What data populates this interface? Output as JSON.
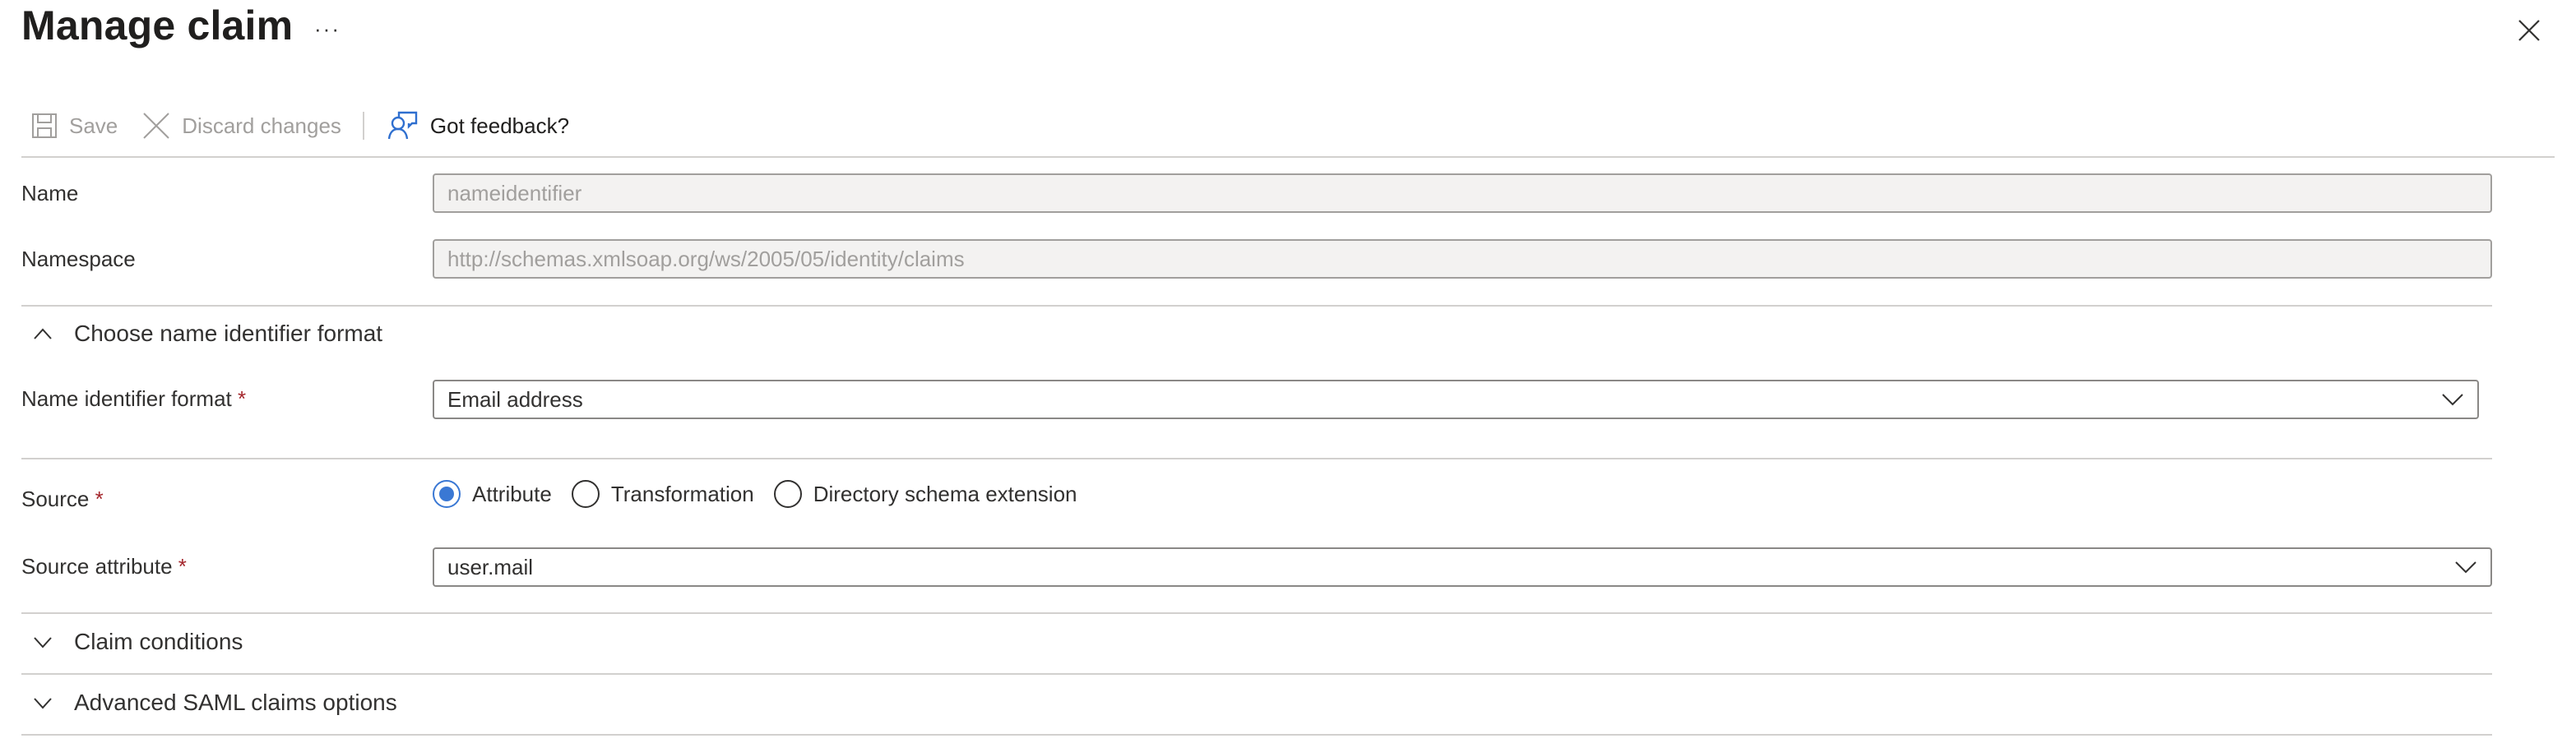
{
  "header": {
    "title": "Manage claim",
    "more_label": "···",
    "close_icon": "close-icon"
  },
  "toolbar": {
    "save_label": "Save",
    "discard_label": "Discard changes",
    "feedback_label": "Got feedback?"
  },
  "form": {
    "name": {
      "label": "Name",
      "value": "nameidentifier"
    },
    "namespace": {
      "label": "Namespace",
      "value": "http://schemas.xmlsoap.org/ws/2005/05/identity/claims"
    },
    "name_id_section": {
      "title": "Choose name identifier format",
      "expanded": true
    },
    "name_id_format": {
      "label": "Name identifier format",
      "required_mark": "*",
      "value": "Email address"
    },
    "source": {
      "label": "Source",
      "required_mark": "*",
      "options": [
        {
          "label": "Attribute",
          "selected": true
        },
        {
          "label": "Transformation",
          "selected": false
        },
        {
          "label": "Directory schema extension",
          "selected": false
        }
      ]
    },
    "source_attribute": {
      "label": "Source attribute",
      "required_mark": "*",
      "value": "user.mail"
    },
    "claim_conditions": {
      "title": "Claim conditions",
      "expanded": false
    },
    "advanced_saml": {
      "title": "Advanced SAML claims options",
      "expanded": false
    }
  },
  "colors": {
    "accent": "#3a78d4",
    "required": "#a4262c",
    "disabled_text": "#a19f9d",
    "disabled_bg": "#f3f2f1",
    "divider": "#d2d0ce"
  }
}
